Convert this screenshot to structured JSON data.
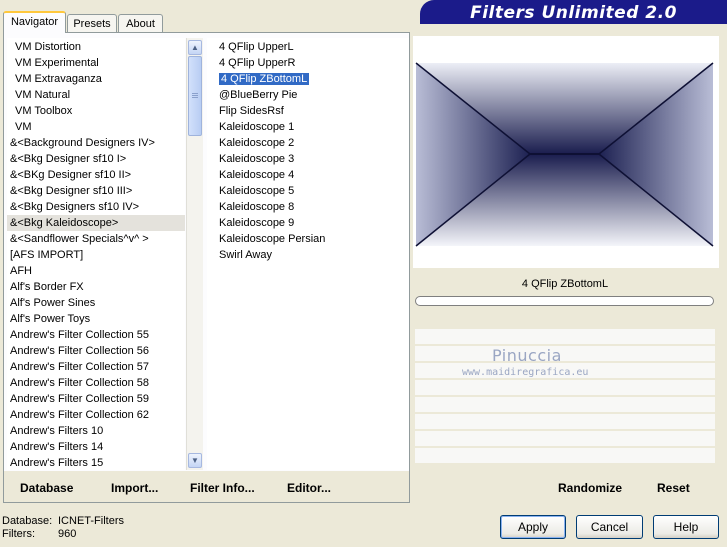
{
  "tabs": [
    {
      "label": "Navigator",
      "active": true
    },
    {
      "label": "Presets",
      "active": false
    },
    {
      "label": "About",
      "active": false
    }
  ],
  "banner": {
    "title": "Filters Unlimited 2.0"
  },
  "categories": [
    {
      "label": "VM Distortion"
    },
    {
      "label": "VM Experimental"
    },
    {
      "label": "VM Extravaganza"
    },
    {
      "label": "VM Natural"
    },
    {
      "label": "VM Toolbox"
    },
    {
      "label": "VM"
    },
    {
      "label": "&<Background Designers IV>"
    },
    {
      "label": "&<Bkg Designer sf10 I>"
    },
    {
      "label": "&<BKg Designer sf10 II>"
    },
    {
      "label": "&<Bkg Designer sf10 III>"
    },
    {
      "label": "&<Bkg Designers sf10 IV>"
    },
    {
      "label": "&<Bkg Kaleidoscope>",
      "selected": true
    },
    {
      "label": "&<Sandflower Specials^v^ >"
    },
    {
      "label": "[AFS IMPORT]"
    },
    {
      "label": "AFH"
    },
    {
      "label": "Alf's Border FX"
    },
    {
      "label": "Alf's Power Sines"
    },
    {
      "label": "Alf's Power Toys"
    },
    {
      "label": "Andrew's Filter Collection 55"
    },
    {
      "label": "Andrew's Filter Collection 56"
    },
    {
      "label": "Andrew's Filter Collection 57"
    },
    {
      "label": "Andrew's Filter Collection 58"
    },
    {
      "label": "Andrew's Filter Collection 59"
    },
    {
      "label": "Andrew's Filter Collection 62"
    },
    {
      "label": "Andrew's Filters 10"
    },
    {
      "label": "Andrew's Filters 14"
    },
    {
      "label": "Andrew's Filters 15"
    }
  ],
  "filters": [
    {
      "label": "4 QFlip UpperL"
    },
    {
      "label": "4 QFlip UpperR"
    },
    {
      "label": "4 QFlip ZBottomL",
      "selected": true
    },
    {
      "label": "@BlueBerry Pie"
    },
    {
      "label": "Flip SidesRsf"
    },
    {
      "label": "Kaleidoscope 1"
    },
    {
      "label": "Kaleidoscope 2"
    },
    {
      "label": "Kaleidoscope 3"
    },
    {
      "label": "Kaleidoscope 4"
    },
    {
      "label": "Kaleidoscope 5"
    },
    {
      "label": "Kaleidoscope 8"
    },
    {
      "label": "Kaleidoscope 9"
    },
    {
      "label": "Kaleidoscope Persian"
    },
    {
      "label": "Swirl Away"
    }
  ],
  "left_links": {
    "database": "Database",
    "import": "Import...",
    "filter_info": "Filter Info...",
    "editor": "Editor..."
  },
  "right_links": {
    "randomize": "Randomize",
    "reset": "Reset"
  },
  "preview": {
    "filter_name": "4 QFlip ZBottomL",
    "progress": 0
  },
  "watermark": {
    "name": "Pinuccia",
    "site": "www.maidiregrafica.eu"
  },
  "status": {
    "database_label": "Database:",
    "database_value": "ICNET-Filters",
    "filters_label": "Filters:",
    "filters_value": "960"
  },
  "buttons": {
    "apply": "Apply",
    "cancel": "Cancel",
    "help": "Help"
  },
  "colors": {
    "banner": "#1b1b8a",
    "selection": "#316ac5",
    "tab_accent": "#ffc83c"
  }
}
